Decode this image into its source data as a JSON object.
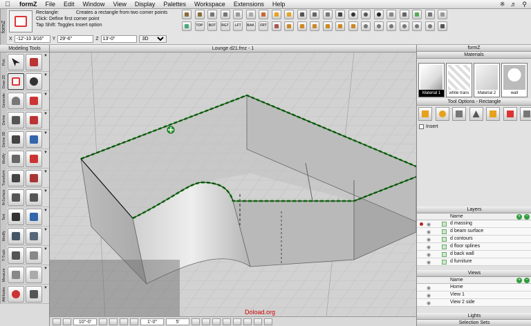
{
  "menubar": {
    "app_name": "formZ",
    "menus": [
      "File",
      "Edit",
      "Window",
      "View",
      "Display",
      "Palettes",
      "Workspace",
      "Extensions",
      "Help"
    ]
  },
  "prompt": {
    "side_tab": "formZ",
    "tool_name": "Rectangle:",
    "tool_desc": "Creates a rectangle from two corner points",
    "line2": "Click: Define first corner point",
    "line3": "Tap Shift: Toggles Insert option",
    "x_label": "X",
    "x_value": "-12'-10 3/16\"",
    "y_label": "Y",
    "y_value": "29'-6\"",
    "z_label": "Z",
    "z_value": "13'-0\"",
    "mode_select": "3D"
  },
  "toolbar": {
    "view_labels": [
      "TOP",
      "BOT",
      "RGT",
      "LFT",
      "BAK",
      "FRT"
    ]
  },
  "modeling_palette": {
    "title": "Modeling Tools",
    "groups": [
      "Pick",
      "Draw 2D",
      "Generate",
      "Derive",
      "Derive 3D",
      "Modify",
      "Transform",
      "N-Surface",
      "Text",
      "Modify",
      "T-Track",
      "Measure",
      "Attributes"
    ]
  },
  "viewport": {
    "title": "Lounge d21.fmz - 1",
    "watermark": "Doload.org"
  },
  "statusbar": {
    "angle": "10°-0'",
    "grid": "1'-0\"",
    "snap": "5'"
  },
  "right_panel": {
    "window_title": "formZ",
    "materials": {
      "title": "Materials",
      "items": [
        "Material 1",
        "white trans",
        "Material 2",
        "wall"
      ]
    },
    "tool_options": {
      "title": "Tool Options - Rectangle",
      "insert_label": "Insert"
    },
    "layers": {
      "title": "Layers",
      "name_header": "Name",
      "rows": [
        "d massing",
        "d beam surface",
        "d contours",
        "d floor splines",
        "d back wall",
        "d furniture"
      ]
    },
    "views": {
      "title": "Views",
      "name_header": "Name",
      "rows": [
        "Home",
        "View 1",
        "View 2 side"
      ]
    },
    "lights_title": "Lights",
    "selection_sets_title": "Selection Sets"
  },
  "colors": {
    "accent_green": "#2e9c3a",
    "active_red": "#d33333",
    "watermark_red": "#cc0000"
  }
}
